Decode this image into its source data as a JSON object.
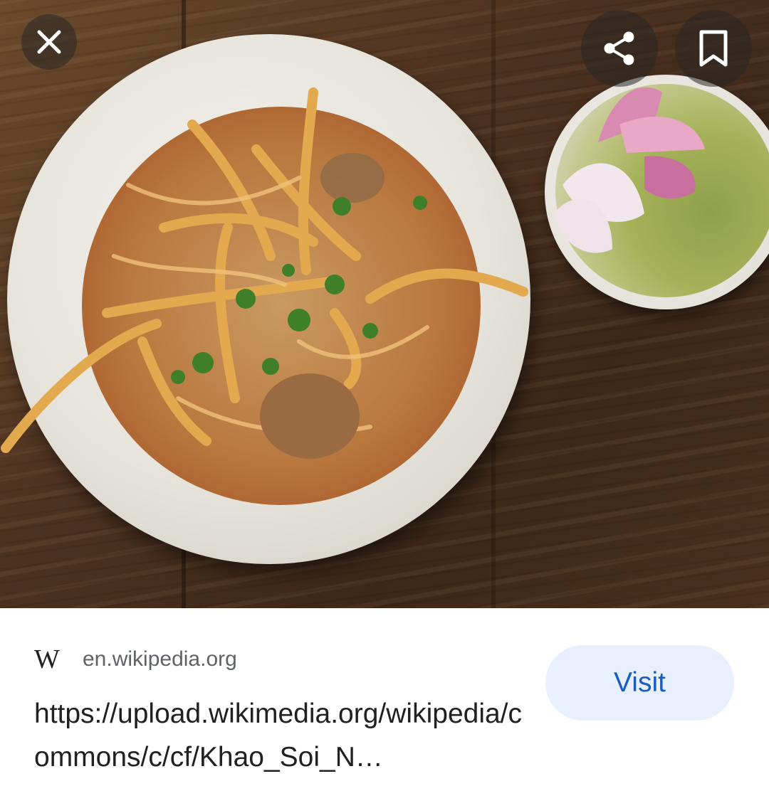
{
  "viewer": {
    "close_icon": "close-icon",
    "share_icon": "share-icon",
    "bookmark_icon": "bookmark-icon",
    "image_subject": "khao-soi-photo"
  },
  "source": {
    "logo_text": "W",
    "domain": "en.wikipedia.org",
    "url": "https://upload.wikimedia.org/wikipedia/commons/c/cf/Khao_Soi_N…",
    "visit_label": "Visit"
  },
  "colors": {
    "visit_bg": "#e8f0fe",
    "visit_text": "#1a5bc4",
    "overlay_button": "rgba(40,38,36,0.55)"
  }
}
